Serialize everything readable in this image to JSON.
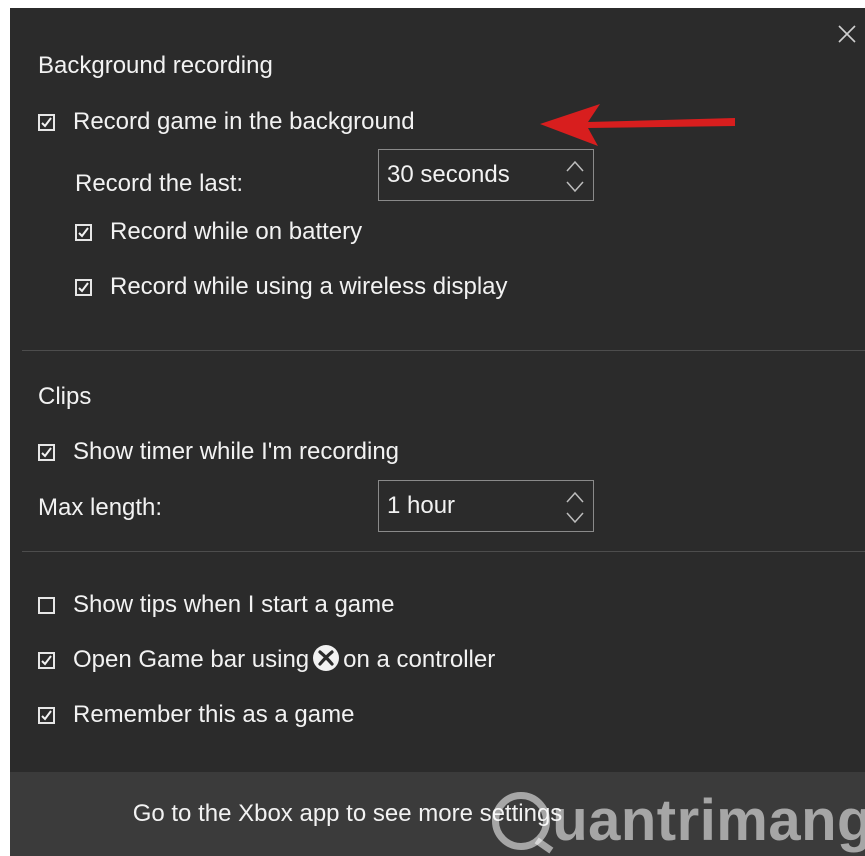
{
  "window": {
    "close_icon": "close-icon"
  },
  "background_recording": {
    "title": "Background recording",
    "record_in_background": {
      "label": "Record game in the background",
      "checked": true
    },
    "record_last": {
      "label": "Record the last:",
      "value": "30 seconds"
    },
    "on_battery": {
      "label": "Record while on battery",
      "checked": true
    },
    "wireless_display": {
      "label": "Record while using a wireless display",
      "checked": true
    }
  },
  "clips": {
    "title": "Clips",
    "show_timer": {
      "label": "Show timer while I'm recording",
      "checked": true
    },
    "max_length": {
      "label": "Max length:",
      "value": "1 hour"
    }
  },
  "general": {
    "show_tips": {
      "label": "Show tips when I start a game",
      "checked": false
    },
    "open_game_bar": {
      "label_before": "Open Game bar using",
      "label_after": "on a controller",
      "icon": "xbox-button-icon",
      "checked": true
    },
    "remember_game": {
      "label": "Remember this as a game",
      "checked": true
    }
  },
  "footer": {
    "link": "Go to the Xbox app to see more settings"
  },
  "watermark": {
    "text": "uantrimang"
  },
  "annotation": {
    "arrow_color": "#d81e1e"
  }
}
